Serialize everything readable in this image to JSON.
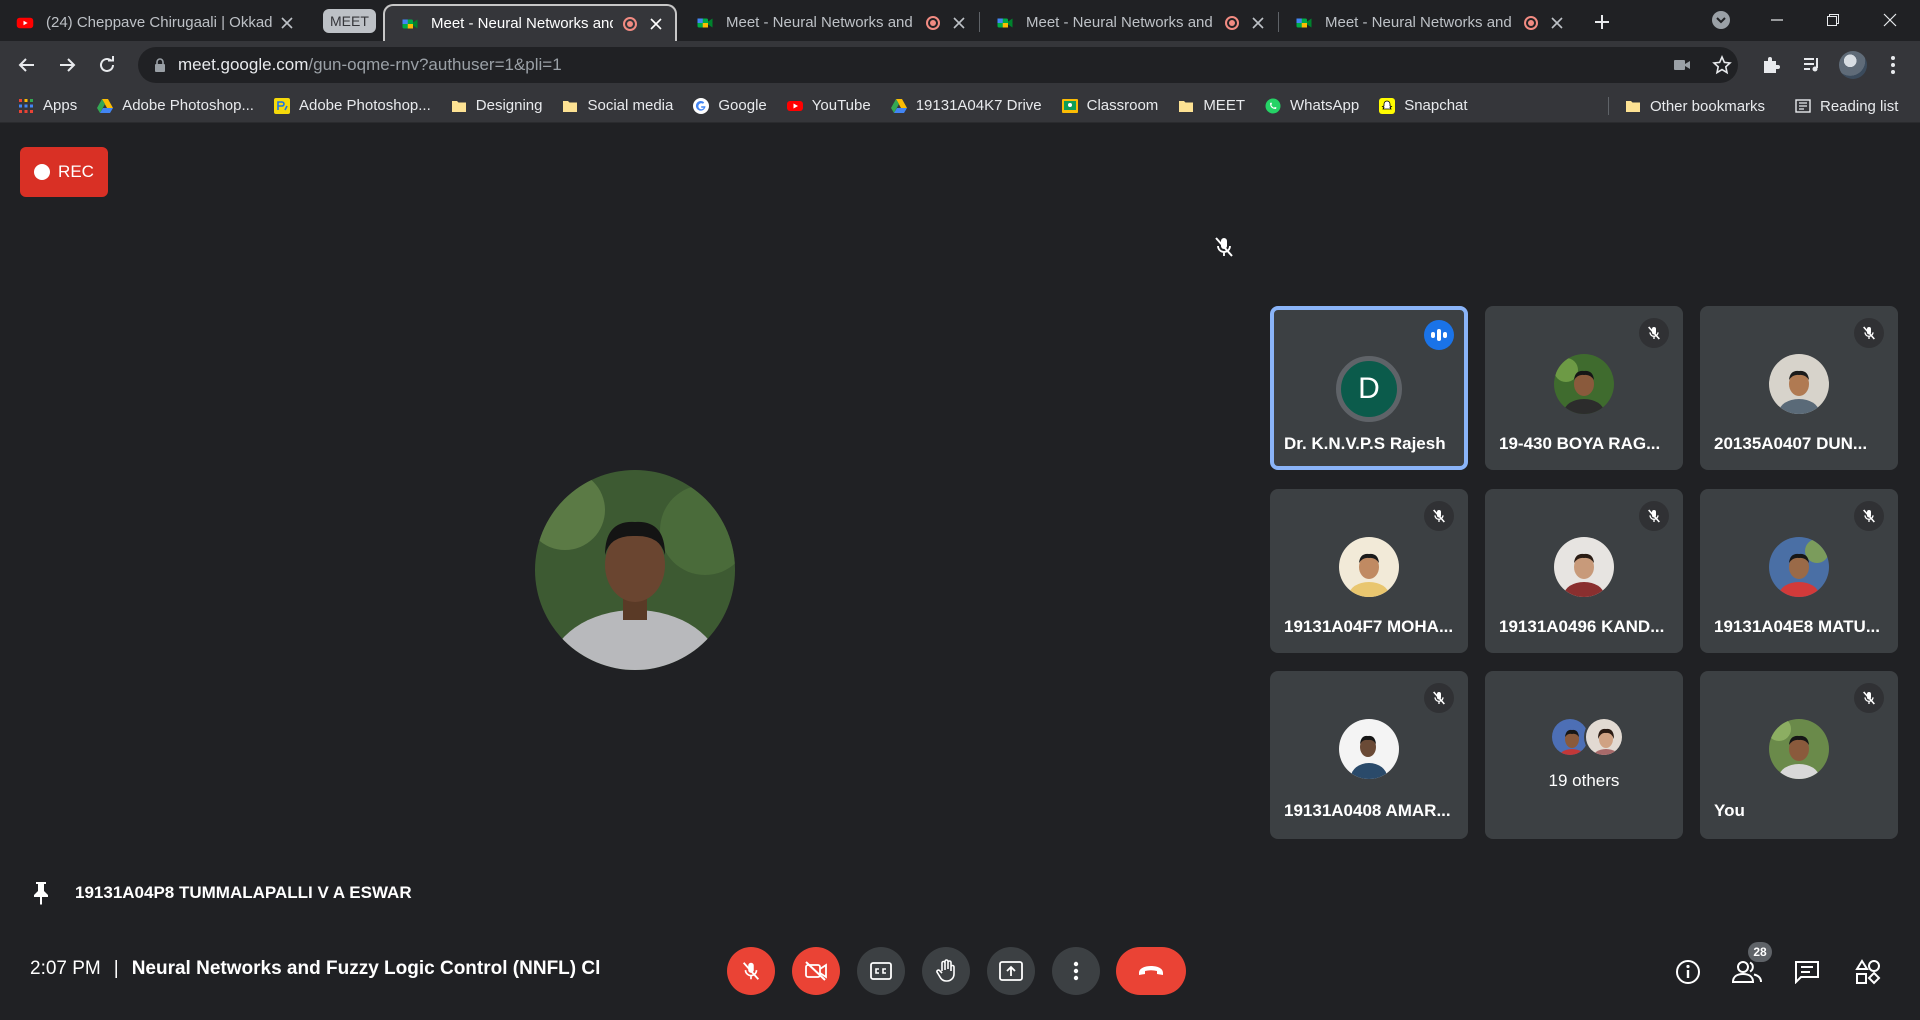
{
  "browser": {
    "tabs": [
      {
        "title": "(24) Cheppave Chirugaali | Okkad",
        "favicon": "youtube-icon"
      },
      {
        "title": "Meet - Neural Networks and Fuzzy Logic Control",
        "favicon": "meet-icon",
        "recording": true
      },
      {
        "title": "Meet - Neural Networks and Fuzzy Logic Control",
        "favicon": "meet-icon",
        "recording": true
      },
      {
        "title": "Meet - Neural Networks and Fuzzy Logic Control",
        "favicon": "meet-icon",
        "recording": true
      },
      {
        "title": "Meet - Neural Networks and Fuzzy Logic Control",
        "favicon": "meet-icon",
        "recording": true
      }
    ],
    "tab_group_label": "MEET",
    "address": {
      "host": "meet.google.com",
      "path": "/gun-oqme-rnv?authuser=1&pli=1"
    },
    "bookmarks": [
      {
        "label": "Apps",
        "icon": "apps-grid-icon"
      },
      {
        "label": "Adobe Photoshop...",
        "icon": "drive-icon"
      },
      {
        "label": "Adobe Photoshop...",
        "icon": "photoshop-app-icon"
      },
      {
        "label": "Designing",
        "icon": "folder-icon"
      },
      {
        "label": "Social media",
        "icon": "folder-icon"
      },
      {
        "label": "Google",
        "icon": "google-icon"
      },
      {
        "label": "YouTube",
        "icon": "youtube-icon"
      },
      {
        "label": "19131A04K7 Drive",
        "icon": "drive-icon"
      },
      {
        "label": "Classroom",
        "icon": "classroom-icon"
      },
      {
        "label": "MEET",
        "icon": "folder-icon"
      },
      {
        "label": "WhatsApp",
        "icon": "whatsapp-icon"
      },
      {
        "label": "Snapchat",
        "icon": "snapchat-icon"
      }
    ],
    "other_bookmarks": "Other bookmarks",
    "reading_list": "Reading list"
  },
  "meet": {
    "rec_label": "REC",
    "pinned_name": "19131A04P8 TUMMALAPALLI V A ESWAR",
    "participants": [
      {
        "name": "Dr. K.N.V.P.S Rajesh",
        "avatar": "letter",
        "letter": "D",
        "speaking": true
      },
      {
        "name": "19-430 BOYA RAG...",
        "avatar": "photo",
        "muted": true
      },
      {
        "name": "20135A0407 DUN...",
        "avatar": "photo",
        "muted": true
      },
      {
        "name": "19131A04F7 MOHA...",
        "avatar": "photo",
        "muted": true
      },
      {
        "name": "19131A0496 KAND...",
        "avatar": "photo",
        "muted": true
      },
      {
        "name": "19131A04E8 MATU...",
        "avatar": "photo",
        "muted": true
      },
      {
        "name": "19131A0408 AMAR...",
        "avatar": "photo",
        "muted": true
      },
      {
        "name": "19 others",
        "avatar": "group"
      },
      {
        "name": "You",
        "avatar": "photo",
        "muted": true
      }
    ],
    "time": "2:07 PM",
    "separator": "|",
    "meeting_title": "Neural Networks and Fuzzy Logic Control (NNFL) Cl",
    "participant_count": "28",
    "colors": {
      "leave": "#ea4335",
      "speaking_border": "#8ab4f8",
      "rec": "#d93025"
    }
  }
}
